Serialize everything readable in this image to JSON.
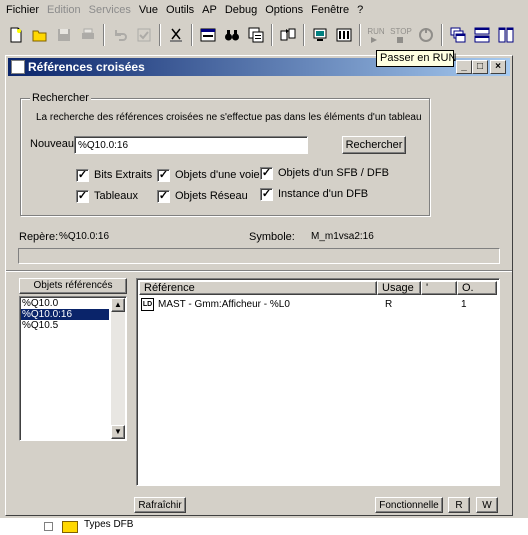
{
  "menubar": {
    "items": [
      {
        "label": "Fichier",
        "enabled": true
      },
      {
        "label": "Edition",
        "enabled": false
      },
      {
        "label": "Services",
        "enabled": false
      },
      {
        "label": "Vue",
        "enabled": true
      },
      {
        "label": "Outils",
        "enabled": true
      },
      {
        "label": "AP",
        "enabled": true
      },
      {
        "label": "Debug",
        "enabled": true
      },
      {
        "label": "Options",
        "enabled": true
      },
      {
        "label": "Fenêtre",
        "enabled": true
      },
      {
        "label": "?",
        "enabled": true
      }
    ]
  },
  "toolbar": {
    "run_label": "RUN",
    "stop_label": "STOP",
    "tooltip": "Passer en RUN"
  },
  "window": {
    "title": "Références croisées"
  },
  "search": {
    "group_title": "Rechercher",
    "note": "La recherche des références croisées ne s'effectue pas dans les éléments d'un tableau",
    "new_label": "Nouveau",
    "value": "%Q10.0:16",
    "button_label": "Rechercher",
    "options": [
      {
        "label": "Bits Extraits",
        "checked": true
      },
      {
        "label": "Objets d'une voie",
        "checked": true
      },
      {
        "label": "Objets d'un SFB / DFB",
        "checked": true
      },
      {
        "label": "Tableaux",
        "checked": true
      },
      {
        "label": "Objets Réseau",
        "checked": true
      },
      {
        "label": "Instance d'un DFB",
        "checked": true
      }
    ]
  },
  "info": {
    "repere_label": "Repère:",
    "repere_value": "%Q10.0:16",
    "symbole_label": "Symbole:",
    "symbole_value": "M_m1vsa2:16"
  },
  "objects": {
    "header": "Objets référencés",
    "items": [
      {
        "label": "%Q10.0",
        "selected": false
      },
      {
        "label": "%Q10.0:16",
        "selected": true
      },
      {
        "label": "%Q10.5",
        "selected": false
      }
    ]
  },
  "references": {
    "columns": [
      "Référence",
      "Usage",
      "'",
      "O."
    ],
    "rows": [
      {
        "icon": "LD",
        "reference": "MAST - Gmm:Afficheur - %L0",
        "usage": "R",
        "mark": "",
        "occ": "1"
      }
    ]
  },
  "footer": {
    "refresh_label": "Rafraîchir",
    "functional_label": "Fonctionnelle",
    "r_label": "R",
    "w_label": "W",
    "background_text": "Types DFB"
  }
}
